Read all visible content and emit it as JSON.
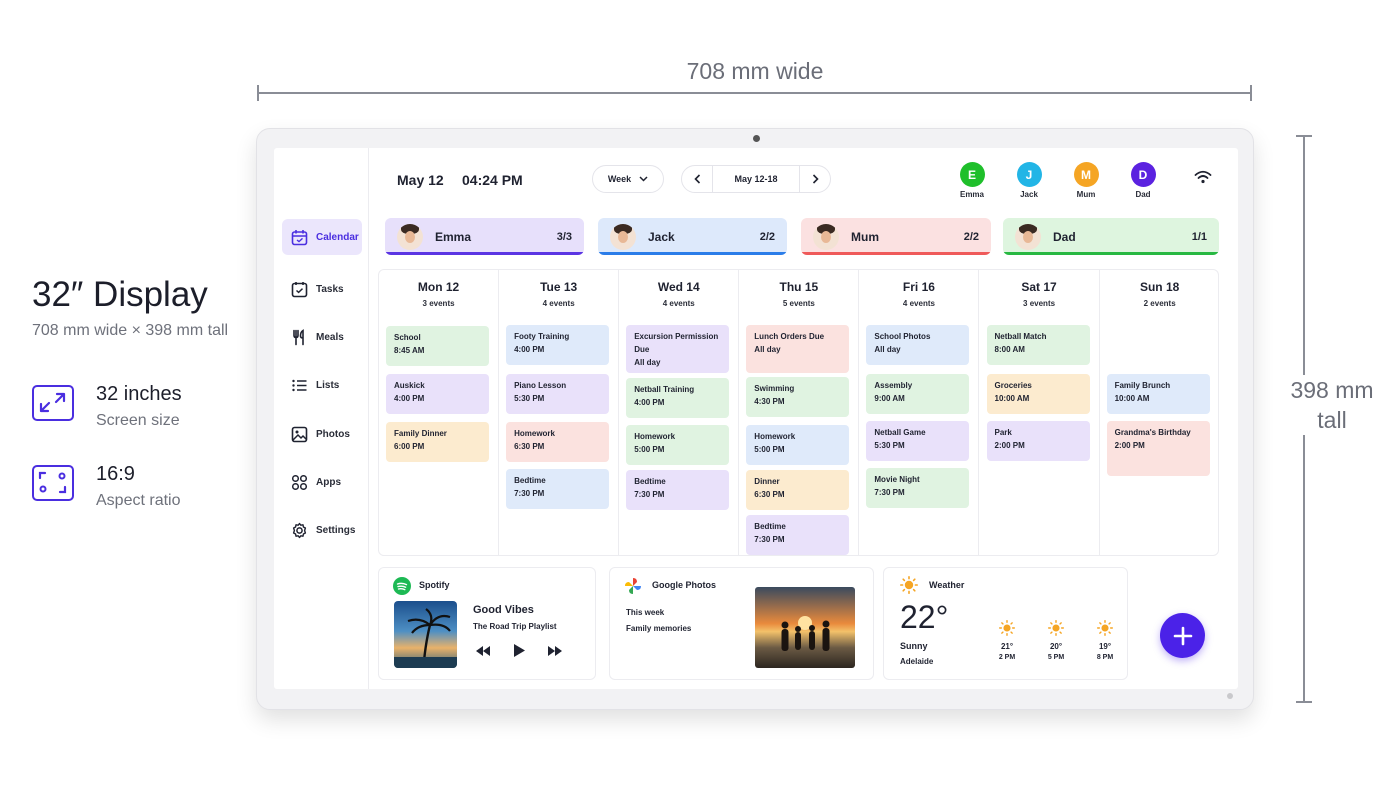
{
  "dimensions": {
    "width_label": "708 mm wide",
    "height_label_line1": "398 mm",
    "height_label_line2": "tall"
  },
  "spec": {
    "title": "32″ Display",
    "subtitle": "708 mm wide × 398 mm tall",
    "size_value": "32 inches",
    "size_label": "Screen size",
    "ratio_value": "16:9",
    "ratio_label": "Aspect ratio",
    "icon_color": "#4a2ee0"
  },
  "sidebar": {
    "items": [
      {
        "label": "Calendar",
        "icon": "calendar-icon",
        "active": true
      },
      {
        "label": "Tasks",
        "icon": "tasks-icon"
      },
      {
        "label": "Meals",
        "icon": "meals-icon"
      },
      {
        "label": "Lists",
        "icon": "lists-icon"
      },
      {
        "label": "Photos",
        "icon": "photos-icon"
      },
      {
        "label": "Apps",
        "icon": "apps-icon"
      },
      {
        "label": "Settings",
        "icon": "settings-icon"
      }
    ]
  },
  "header": {
    "date": "May 12",
    "time": "04:24 PM",
    "view_select": "Week",
    "range": "May 12-18",
    "avatars": [
      {
        "initial": "E",
        "name": "Emma",
        "color": "#1fbf2b"
      },
      {
        "initial": "J",
        "name": "Jack",
        "color": "#22b5e6"
      },
      {
        "initial": "M",
        "name": "Mum",
        "color": "#f5a524"
      },
      {
        "initial": "D",
        "name": "Dad",
        "color": "#5b22e0"
      }
    ]
  },
  "members": [
    {
      "name": "Emma",
      "count": "3/3",
      "bg": "#e7e0fb",
      "bar": "#5b35e3"
    },
    {
      "name": "Jack",
      "count": "2/2",
      "bg": "#dde9fb",
      "bar": "#2b7de9"
    },
    {
      "name": "Mum",
      "count": "2/2",
      "bg": "#fbe1e1",
      "bar": "#ef5a5a"
    },
    {
      "name": "Dad",
      "count": "1/1",
      "bg": "#def5df",
      "bar": "#27b842"
    }
  ],
  "days": [
    {
      "label": "Mon 12",
      "count": "3 events",
      "events": [
        {
          "title": "School",
          "time": "8:45 AM",
          "color": "#e0f3e1"
        },
        {
          "title": "Auskick",
          "time": "4:00 PM",
          "color": "#e9e1fa"
        },
        {
          "title": "Family Dinner",
          "time": "6:00 PM",
          "color": "#fcebcf"
        }
      ]
    },
    {
      "label": "Tue 13",
      "count": "4 events",
      "events": [
        {
          "title": "Footy Training",
          "time": "4:00 PM",
          "color": "#dfeafa"
        },
        {
          "title": "Piano Lesson",
          "time": "5:30 PM",
          "color": "#e9e1fa"
        },
        {
          "title": "Homework",
          "time": "6:30 PM",
          "color": "#fbe2df"
        },
        {
          "title": "Bedtime",
          "time": "7:30 PM",
          "color": "#dfeafa"
        }
      ]
    },
    {
      "label": "Wed 14",
      "count": "4 events",
      "events": [
        {
          "title": "Excursion Permission Due",
          "time": "All day",
          "color": "#e9e1fa"
        },
        {
          "title": "Netball Training",
          "time": "4:00 PM",
          "color": "#e0f3e1"
        },
        {
          "title": "Homework",
          "time": "5:00 PM",
          "color": "#e0f3e1"
        },
        {
          "title": "Bedtime",
          "time": "7:30 PM",
          "color": "#e9e1fa"
        }
      ]
    },
    {
      "label": "Thu 15",
      "count": "5 events",
      "events": [
        {
          "title": "Lunch Orders Due",
          "time": "All day",
          "color": "#fbe2df"
        },
        {
          "title": "Swimming",
          "time": "4:30 PM",
          "color": "#e0f3e1"
        },
        {
          "title": "Homework",
          "time": "5:00 PM",
          "color": "#dfeafa"
        },
        {
          "title": "Dinner",
          "time": "6:30 PM",
          "color": "#fcebcf"
        },
        {
          "title": "Bedtime",
          "time": "7:30 PM",
          "color": "#e9e1fa"
        }
      ]
    },
    {
      "label": "Fri 16",
      "count": "4 events",
      "events": [
        {
          "title": "School Photos",
          "time": "All day",
          "color": "#dfeafa"
        },
        {
          "title": "Assembly",
          "time": "9:00 AM",
          "color": "#e0f3e1"
        },
        {
          "title": "Netball Game",
          "time": "5:30 PM",
          "color": "#e9e1fa"
        },
        {
          "title": "Movie Night",
          "time": "7:30 PM",
          "color": "#e0f3e1"
        }
      ]
    },
    {
      "label": "Sat 17",
      "count": "3 events",
      "events": [
        {
          "title": "Netball Match",
          "time": "8:00 AM",
          "color": "#e0f3e1"
        },
        {
          "title": "Groceries",
          "time": "10:00 AM",
          "color": "#fcebcf"
        },
        {
          "title": "Park",
          "time": "2:00 PM",
          "color": "#e9e1fa"
        }
      ]
    },
    {
      "label": "Sun 18",
      "count": "2 events",
      "events": [
        {
          "title": "Family Brunch",
          "time": "10:00 AM",
          "color": "#dfeafa"
        },
        {
          "title": "Grandma's Birthday",
          "time": "2:00 PM",
          "color": "#fbe2df"
        }
      ]
    }
  ],
  "spotify": {
    "title": "Spotify",
    "track": "Good Vibes",
    "playlist": "The Road Trip Playlist"
  },
  "google_photos": {
    "title": "Google Photos",
    "line1": "This week",
    "line2": "Family memories"
  },
  "weather": {
    "title": "Weather",
    "temp": "22°",
    "condition": "Sunny",
    "location": "Adelaide",
    "forecast": [
      {
        "temp": "21°",
        "time": "2 PM"
      },
      {
        "temp": "20°",
        "time": "5 PM"
      },
      {
        "temp": "19°",
        "time": "8 PM"
      }
    ]
  },
  "accent": "#4b22e8"
}
